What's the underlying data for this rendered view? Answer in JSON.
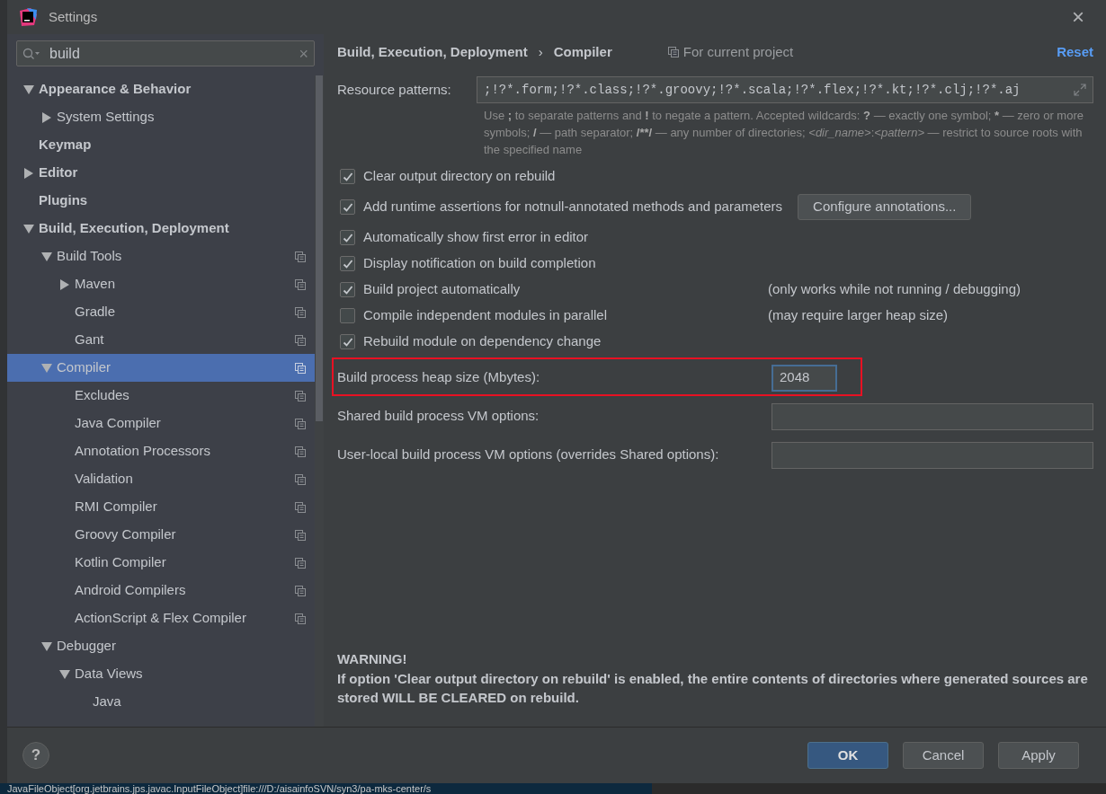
{
  "window": {
    "title": "Settings",
    "close": "×"
  },
  "sidebar": {
    "search": {
      "value": "build",
      "clear": "×"
    },
    "tree": [
      {
        "label": "Appearance & Behavior",
        "expanded": true,
        "selected": false,
        "project_scoped": false,
        "children": [
          {
            "label": "System Settings",
            "expanded": false,
            "selected": false,
            "project_scoped": false,
            "has_children": true
          }
        ]
      },
      {
        "label": "Keymap",
        "selected": false,
        "project_scoped": false
      },
      {
        "label": "Editor",
        "expanded": false,
        "has_children": true,
        "selected": false,
        "project_scoped": false
      },
      {
        "label": "Plugins",
        "selected": false,
        "project_scoped": false
      },
      {
        "label": "Build, Execution, Deployment",
        "expanded": true,
        "selected": false,
        "project_scoped": false,
        "children": [
          {
            "label": "Build Tools",
            "expanded": true,
            "selected": false,
            "project_scoped": true,
            "children": [
              {
                "label": "Maven",
                "expanded": false,
                "has_children": true,
                "selected": false,
                "project_scoped": true
              },
              {
                "label": "Gradle",
                "selected": false,
                "project_scoped": true
              },
              {
                "label": "Gant",
                "selected": false,
                "project_scoped": true
              }
            ]
          },
          {
            "label": "Compiler",
            "expanded": true,
            "selected": true,
            "project_scoped": true,
            "children": [
              {
                "label": "Excludes",
                "selected": false,
                "project_scoped": true
              },
              {
                "label": "Java Compiler",
                "selected": false,
                "project_scoped": true
              },
              {
                "label": "Annotation Processors",
                "selected": false,
                "project_scoped": true
              },
              {
                "label": "Validation",
                "selected": false,
                "project_scoped": true
              },
              {
                "label": "RMI Compiler",
                "selected": false,
                "project_scoped": true
              },
              {
                "label": "Groovy Compiler",
                "selected": false,
                "project_scoped": true
              },
              {
                "label": "Kotlin Compiler",
                "selected": false,
                "project_scoped": true
              },
              {
                "label": "Android Compilers",
                "selected": false,
                "project_scoped": true
              },
              {
                "label": "ActionScript & Flex Compiler",
                "selected": false,
                "project_scoped": true
              }
            ]
          },
          {
            "label": "Debugger",
            "expanded": true,
            "selected": false,
            "project_scoped": false,
            "children": [
              {
                "label": "Data Views",
                "expanded": true,
                "selected": false,
                "project_scoped": false,
                "children": [
                  {
                    "label": "Java",
                    "selected": false,
                    "project_scoped": false
                  }
                ]
              }
            ]
          }
        ]
      }
    ]
  },
  "content": {
    "breadcrumb": [
      "Build, Execution, Deployment",
      "Compiler"
    ],
    "breadcrumb_separator": "›",
    "scope": "For current project",
    "reset": "Reset",
    "resource_patterns": {
      "label": "Resource patterns:",
      "value": ";!?*.form;!?*.class;!?*.groovy;!?*.scala;!?*.flex;!?*.kt;!?*.clj;!?*.aj",
      "hint": [
        {
          "text": "Use ",
          "kind": "plain"
        },
        {
          "text": ";",
          "kind": "bold"
        },
        {
          "text": " to separate patterns and ",
          "kind": "plain"
        },
        {
          "text": "!",
          "kind": "bold"
        },
        {
          "text": " to negate a pattern. Accepted wildcards: ",
          "kind": "plain"
        },
        {
          "text": "?",
          "kind": "bold"
        },
        {
          "text": " — exactly one symbol; ",
          "kind": "plain"
        },
        {
          "text": "*",
          "kind": "bold"
        },
        {
          "text": " — zero or more symbols; ",
          "kind": "plain"
        },
        {
          "text": "/",
          "kind": "bold"
        },
        {
          "text": " — path separator; ",
          "kind": "plain"
        },
        {
          "text": "/**/",
          "kind": "bold"
        },
        {
          "text": " — any number of directories; ",
          "kind": "plain"
        },
        {
          "text": "<dir_name>",
          "kind": "italic"
        },
        {
          "text": ":",
          "kind": "plain"
        },
        {
          "text": "<pattern>",
          "kind": "italic"
        },
        {
          "text": " — restrict to source roots with the specified name",
          "kind": "plain"
        }
      ]
    },
    "options": [
      {
        "label": "Clear output directory on rebuild",
        "checked": true
      },
      {
        "label": "Add runtime assertions for notnull-annotated methods and parameters",
        "checked": true,
        "button": "Configure annotations..."
      },
      {
        "label": "Automatically show first error in editor",
        "checked": true
      },
      {
        "label": "Display notification on build completion",
        "checked": true
      },
      {
        "label": "Build project automatically",
        "checked": true,
        "note": "(only works while not running / debugging)"
      },
      {
        "label": "Compile independent modules in parallel",
        "checked": false,
        "note": "(may require larger heap size)"
      },
      {
        "label": "Rebuild module on dependency change",
        "checked": true
      }
    ],
    "fields": [
      {
        "label": "Build process heap size (Mbytes):",
        "value": "2048",
        "kind": "short",
        "highlighted": true,
        "focused": true
      },
      {
        "label": "Shared build process VM options:",
        "kind": "wide",
        "highlighted": false,
        "focused": false
      },
      {
        "label": "User-local build process VM options (overrides Shared options):",
        "kind": "wide",
        "highlighted": false,
        "focused": false
      }
    ],
    "warning": {
      "title": "WARNING!",
      "text": "If option 'Clear output directory on rebuild' is enabled, the entire contents of directories where generated sources are stored WILL BE CLEARED on rebuild."
    }
  },
  "footer": {
    "help": "?",
    "buttons": [
      {
        "label": "OK",
        "default": true
      },
      {
        "label": "Cancel",
        "default": false
      },
      {
        "label": "Apply",
        "default": false
      }
    ]
  },
  "background": {
    "status_text": "JavaFileObject[org.jetbrains.jps.javac.InputFileObject]file:///D:/aisainfoSVN/syn3/pa-mks-center/s"
  }
}
